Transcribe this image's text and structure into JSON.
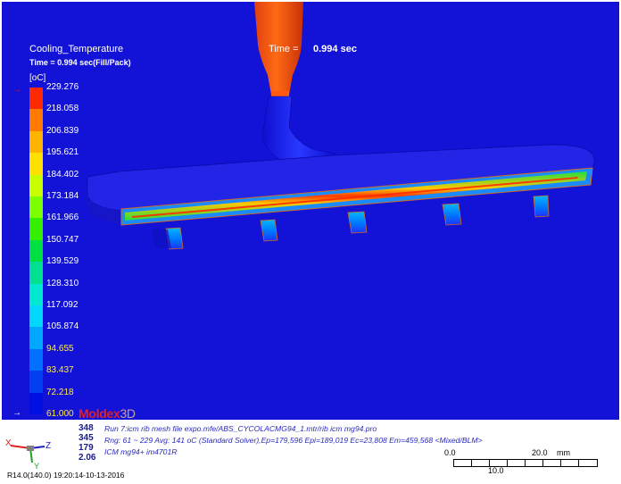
{
  "result": {
    "title": "Cooling_Temperature",
    "subtitle": "Time = 0.994 sec(Fill/Pack)",
    "unit": "[oC]",
    "time_label": "Time =",
    "time_value": "0.994 sec"
  },
  "legend": {
    "max_marker": "→",
    "min_marker": "→",
    "tick_labels": [
      "229.276",
      "218.058",
      "206.839",
      "195.621",
      "184.402",
      "173.184",
      "161.966",
      "150.747",
      "139.529",
      "128.310",
      "117.092",
      "105.874",
      "94.655",
      "83.437",
      "72.218",
      "61.000"
    ],
    "colors": [
      "#ff2a00",
      "#ff7a00",
      "#ffb400",
      "#ffe000",
      "#c8ff00",
      "#7cff00",
      "#34f000",
      "#00e040",
      "#00e090",
      "#00e8d0",
      "#00d8ff",
      "#00a8ff",
      "#0070ff",
      "#0040f0",
      "#0010e0"
    ]
  },
  "brand": {
    "name": "Moldex",
    "suffix": "3D"
  },
  "mesh_info": {
    "numbers": [
      "348",
      "345",
      "179",
      "2.06"
    ],
    "line1": "Run 7:icm rib mesh file expo.mfe/ABS_CYCOLACMG94_1.mtr/rib icm mg94.pro",
    "line2": "Rng: 61 ~ 229  Avg: 141 oC (Standard Solver),Ep=179,596 Epi=189,019 Ec=23,808 Em=459,568  <Mixed/BLM>",
    "line3": "ICM mg94+ im4701R"
  },
  "scale": {
    "left": "0.0",
    "middle": "10.0",
    "right": "20.0",
    "unit": "mm"
  },
  "axes": {
    "x": "X",
    "y": "Y",
    "z": "Z"
  },
  "version": "R14.0(140.0) 19:20:14-10-13-2016"
}
